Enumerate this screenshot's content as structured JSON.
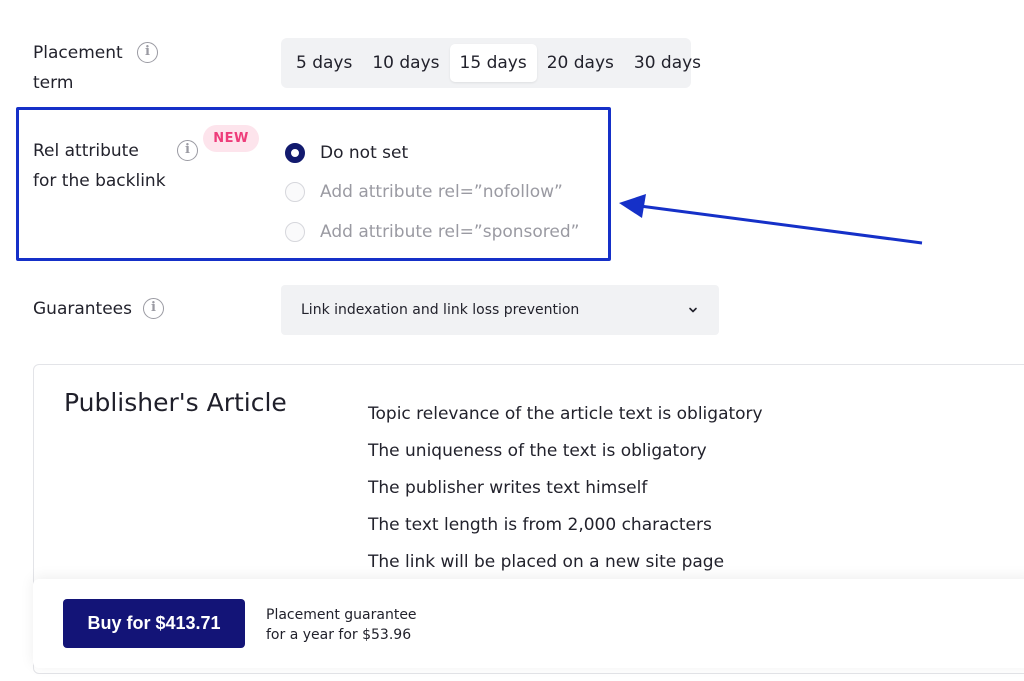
{
  "placement_term": {
    "label_line1": "Placement",
    "label_line2": "term",
    "options": [
      "5 days",
      "10 days",
      "15 days",
      "20 days",
      "30 days"
    ],
    "selected": "15 days"
  },
  "rel_attribute": {
    "label_line1": "Rel attribute",
    "label_line2": "for the backlink",
    "badge": "NEW",
    "options": [
      {
        "label": "Do not set",
        "checked": true
      },
      {
        "label": "Add attribute rel=”nofollow”",
        "checked": false
      },
      {
        "label": "Add attribute rel=”sponsored”",
        "checked": false
      }
    ]
  },
  "guarantees": {
    "label": "Guarantees",
    "value": "Link indexation and link loss prevention"
  },
  "article": {
    "title": "Publisher's Article",
    "features": [
      "Topic relevance of the article text is obligatory",
      "The uniqueness of the text is obligatory",
      "The publisher writes text himself",
      "The text length is from 2,000 characters",
      "The link will be placed on a new site page"
    ]
  },
  "purchase": {
    "buy_label": "Buy for $413.71",
    "guarantee_line1": "Placement guarantee",
    "guarantee_line2": "for a year for $53.96"
  },
  "icons": {
    "info": "info-icon",
    "chevron": "chevron-down-icon",
    "arrow": "annotation-arrow-icon"
  },
  "colors": {
    "accent": "#131477",
    "highlight": "#1530c8",
    "badge_text": "#ee3c7a",
    "badge_bg": "#fde4ec"
  }
}
